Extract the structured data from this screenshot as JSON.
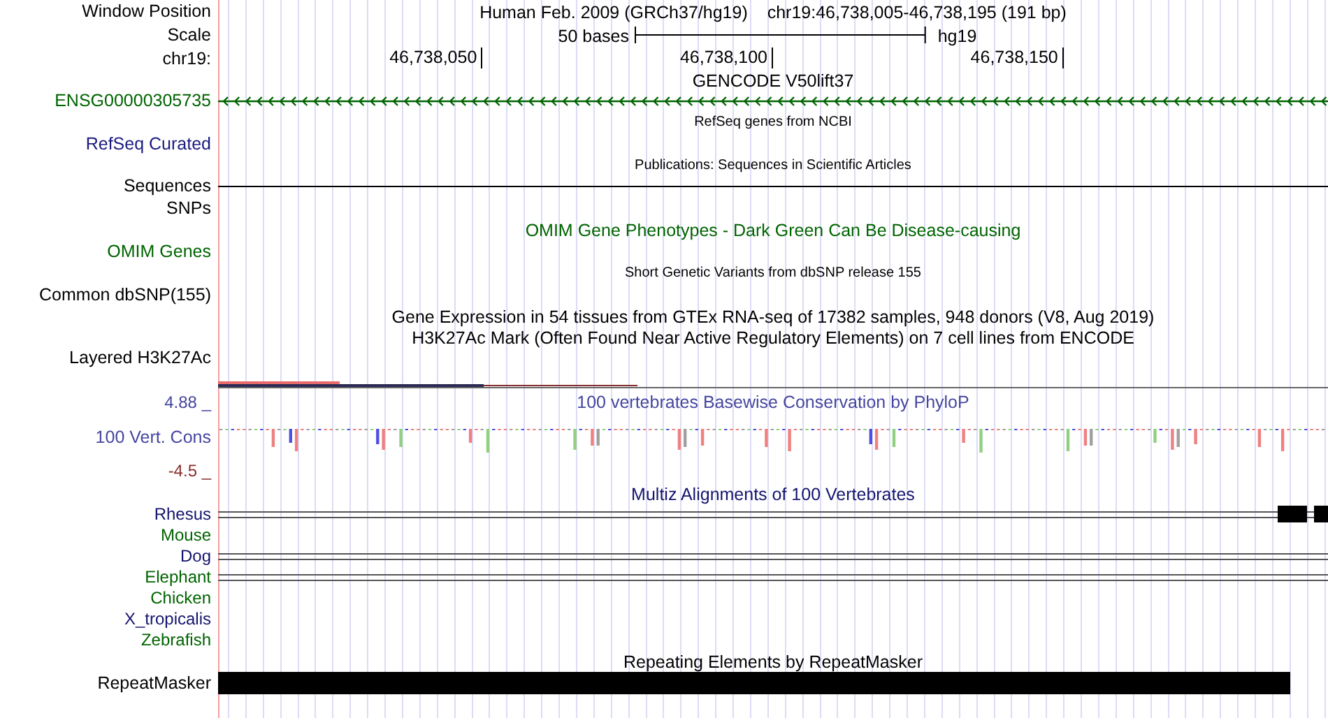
{
  "header": {
    "label": "Window Position",
    "title": "Human Feb. 2009 (GRCh37/hg19)",
    "position": "chr19:46,738,005-46,738,195 (191 bp)"
  },
  "scale": {
    "label": "Scale",
    "length": "50 bases",
    "assembly": "hg19"
  },
  "ruler": {
    "label": "chr19:",
    "ticks": [
      "46,738,050",
      "46,738,100",
      "46,738,150"
    ]
  },
  "tracks": [
    {
      "kind": "title",
      "title": "GENCODE V50lift37",
      "color": "#000000"
    },
    {
      "kind": "gene",
      "label": "ENSG00000305735",
      "color": "#006400"
    },
    {
      "kind": "subtitle",
      "title": "RefSeq genes from NCBI",
      "color": "#000000"
    },
    {
      "kind": "label",
      "label": "RefSeq Curated",
      "color": "#1a1a80"
    },
    {
      "kind": "subtitle",
      "title": "Publications: Sequences in Scientific Articles",
      "color": "#000000"
    },
    {
      "kind": "line",
      "label": "Sequences",
      "color": "#000000"
    },
    {
      "kind": "label",
      "label": "SNPs",
      "color": "#000000"
    },
    {
      "kind": "title",
      "title": "OMIM Gene Phenotypes - Dark Green Can Be Disease-causing",
      "color": "#006400"
    },
    {
      "kind": "label",
      "label": "OMIM Genes",
      "color": "#006400"
    },
    {
      "kind": "subtitle",
      "title": "Short Genetic Variants from dbSNP release 155",
      "color": "#000000"
    },
    {
      "kind": "label",
      "label": "Common dbSNP(155)",
      "color": "#000000"
    },
    {
      "kind": "title",
      "title": "Gene Expression in 54 tissues from GTEx RNA-seq of 17382 samples, 948 donors (V8, Aug 2019)",
      "color": "#000000"
    },
    {
      "kind": "title",
      "title": "H3K27Ac Mark (Often Found Near Active Regulatory Elements) on 7 cell lines from ENCODE",
      "color": "#000000"
    },
    {
      "kind": "layered",
      "label": "Layered H3K27Ac",
      "color": "#000000"
    },
    {
      "kind": "wiggle",
      "label": "100 Vert. Cons",
      "title": "100 vertebrates Basewise Conservation by PhyloP",
      "max": "4.88 _",
      "min": "-4.5 _",
      "color": "#4646a0"
    },
    {
      "kind": "title",
      "title": "Multiz Alignments of 100 Vertebrates",
      "color": "#14146e"
    },
    {
      "kind": "species",
      "label": "Rhesus",
      "color": "#14146e",
      "aligned": true,
      "blocks": true
    },
    {
      "kind": "species",
      "label": "Mouse",
      "color": "#006400",
      "aligned": false,
      "blocks": false
    },
    {
      "kind": "species",
      "label": "Dog",
      "color": "#14146e",
      "aligned": true,
      "blocks": false
    },
    {
      "kind": "species",
      "label": "Elephant",
      "color": "#006400",
      "aligned": true,
      "blocks": false
    },
    {
      "kind": "species",
      "label": "Chicken",
      "color": "#006400",
      "aligned": false,
      "blocks": false
    },
    {
      "kind": "species",
      "label": "X_tropicalis",
      "color": "#14146e",
      "aligned": false,
      "blocks": false
    },
    {
      "kind": "species",
      "label": "Zebrafish",
      "color": "#006400",
      "aligned": false,
      "blocks": false
    },
    {
      "kind": "title",
      "title": "Repeating Elements by RepeatMasker",
      "color": "#000000"
    },
    {
      "kind": "repeat",
      "label": "RepeatMasker",
      "color": "#000000"
    }
  ]
}
